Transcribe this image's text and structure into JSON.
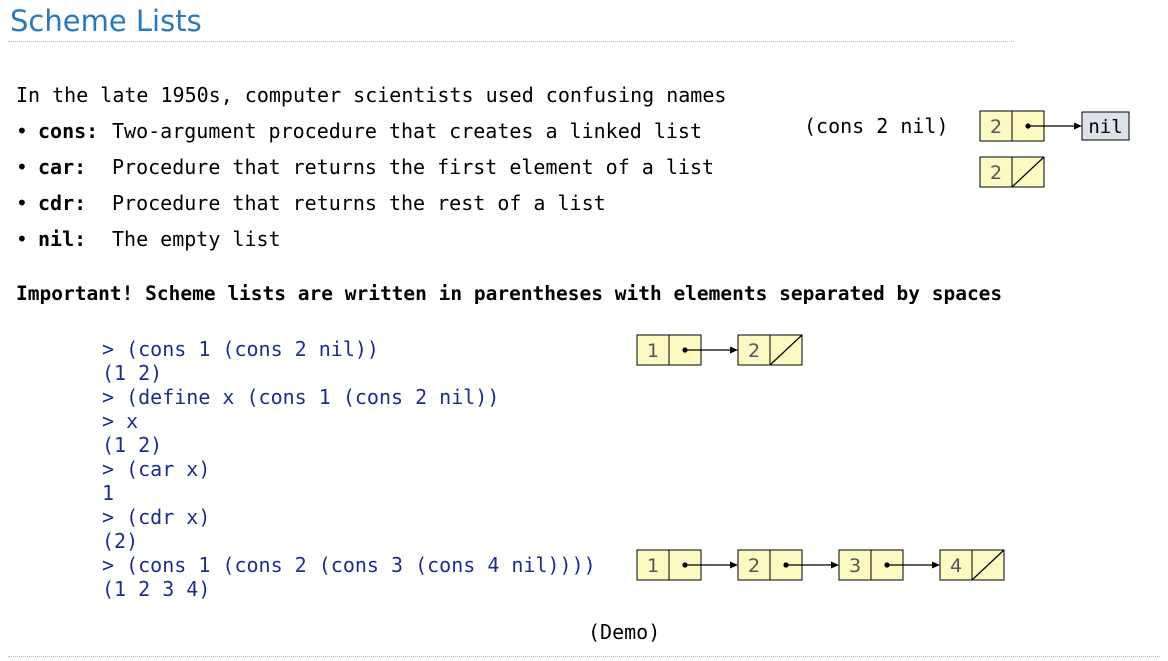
{
  "title": "Scheme Lists",
  "intro": "In the late 1950s, computer scientists used confusing names",
  "definitions": [
    {
      "term": "cons:",
      "desc": "Two-argument procedure that creates a linked list"
    },
    {
      "term": "car:",
      "desc": "Procedure that returns the first element of a list"
    },
    {
      "term": "cdr:",
      "desc": "Procedure that returns the rest of a list"
    },
    {
      "term": "nil:",
      "desc": "The empty list"
    }
  ],
  "bullet": "•",
  "important": "Important! Scheme lists are written in parentheses with elements separated by spaces",
  "session": [
    "> (cons 1 (cons 2 nil))",
    "(1 2)",
    "> (define x (cons 1 (cons 2 nil))",
    "> x",
    "(1 2)",
    "> (car x)",
    "1",
    "> (cdr x)",
    "(2)",
    "> (cons 1 (cons 2 (cons 3 (cons 4 nil))))",
    "(1 2 3 4)"
  ],
  "demo": "(Demo)",
  "cons_example": "(cons 2 nil)",
  "diagrams": {
    "cons_nil": {
      "value": "2",
      "nil_label": "nil"
    },
    "single": {
      "value": "2"
    },
    "list_two": [
      "1",
      "2"
    ],
    "list_four": [
      "1",
      "2",
      "3",
      "4"
    ]
  },
  "colors": {
    "title": "#2a7ab9",
    "code": "#1c2e8c",
    "box_fill": "#fdf9c2",
    "nil_fill": "#dde2ea"
  }
}
